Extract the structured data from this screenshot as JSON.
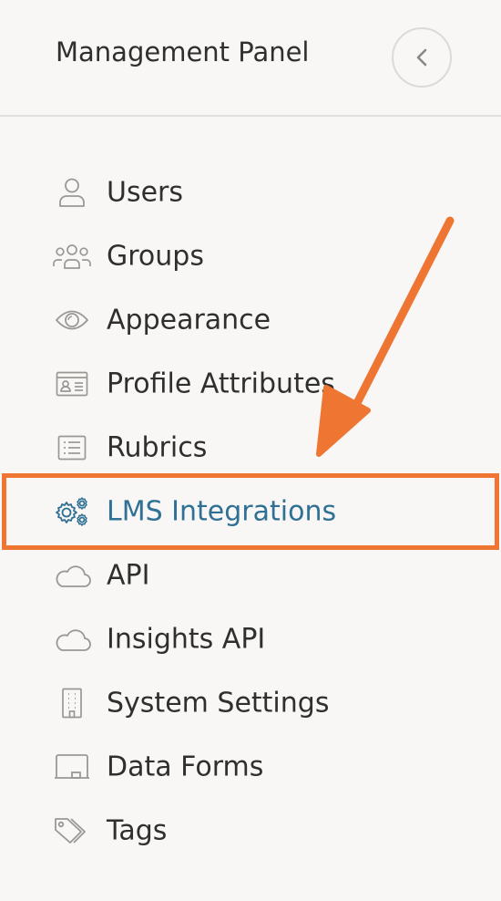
{
  "header": {
    "title": "Management Panel",
    "collapse_icon": "chevron-left-icon"
  },
  "nav": {
    "items": [
      {
        "label": "Users",
        "icon": "user-icon"
      },
      {
        "label": "Groups",
        "icon": "groups-icon"
      },
      {
        "label": "Appearance",
        "icon": "eye-icon"
      },
      {
        "label": "Profile Attributes",
        "icon": "id-card-icon"
      },
      {
        "label": "Rubrics",
        "icon": "list-icon"
      },
      {
        "label": "LMS Integrations",
        "icon": "gears-icon",
        "active": true
      },
      {
        "label": "API",
        "icon": "cloud-icon"
      },
      {
        "label": "Insights API",
        "icon": "cloud-icon"
      },
      {
        "label": "System Settings",
        "icon": "building-icon"
      },
      {
        "label": "Data Forms",
        "icon": "form-icon"
      },
      {
        "label": "Tags",
        "icon": "tags-icon"
      }
    ]
  },
  "colors": {
    "background": "#f8f7f5",
    "text": "#2f2f2f",
    "active_text": "#2f7094",
    "icon": "#9a9894",
    "annotation": "#ee7632"
  }
}
